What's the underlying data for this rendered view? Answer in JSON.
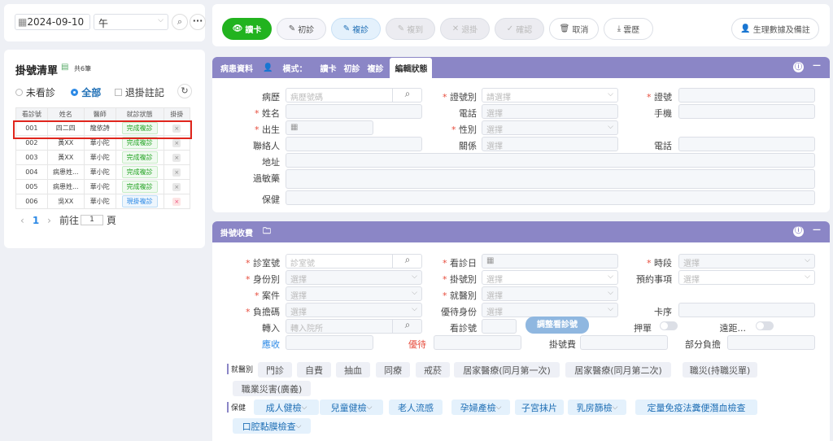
{
  "top": {
    "date": "2024-09-10",
    "session": "午"
  },
  "toolbar": {
    "read_card": "讀卡",
    "first_visit": "初診",
    "revisit": "複診",
    "cut": "複到",
    "clear": "退掛",
    "confirm": "確認",
    "cancel": "取消",
    "cloud": "雲歷",
    "vitals": "生理數據及備註"
  },
  "queue": {
    "title": "掛號清單",
    "total": "共6筆",
    "radio_unseen": "未看診",
    "radio_all": "全部",
    "check_cancelled": "退掛註記",
    "headers": [
      "看診號",
      "姓名",
      "醫師",
      "就診狀態",
      "掛掛"
    ],
    "rows": [
      {
        "no": "001",
        "name": "四二四",
        "doctor": "龍依詩",
        "status": "完成複診",
        "kind": "g",
        "x": "×",
        "xk": ""
      },
      {
        "no": "002",
        "name": "黃XX",
        "doctor": "華小陀",
        "status": "完成複診",
        "kind": "g",
        "x": "×",
        "xk": ""
      },
      {
        "no": "003",
        "name": "黃XX",
        "doctor": "華小陀",
        "status": "完成複診",
        "kind": "g",
        "x": "×",
        "xk": ""
      },
      {
        "no": "004",
        "name": "病患姓...",
        "doctor": "華小陀",
        "status": "完成複診",
        "kind": "g",
        "x": "×",
        "xk": ""
      },
      {
        "no": "005",
        "name": "病患姓...",
        "doctor": "華小陀",
        "status": "完成複診",
        "kind": "g",
        "x": "×",
        "xk": ""
      },
      {
        "no": "006",
        "name": "吳XX",
        "doctor": "華小陀",
        "status": "現掛複診",
        "kind": "b",
        "x": "×",
        "xk": "r"
      }
    ],
    "page": "1",
    "goto": "前往",
    "goto_val": "1",
    "page_unit": "頁"
  },
  "patient": {
    "tabs": [
      "病患資料",
      "模式：",
      "讀卡",
      "初診",
      "複診",
      "編輯狀態"
    ],
    "l_record": "病歷",
    "record_ph": "病歷號碼",
    "l_idtype": "證號別",
    "idtype_ph": "請選擇",
    "l_idno": "證號",
    "l_name": "姓名",
    "l_phone": "電話",
    "phone_ph": "選擇",
    "l_mobile": "手機",
    "l_birth": "出生",
    "l_gender": "性別",
    "gender_ph": "選擇",
    "l_contact": "聯絡人",
    "l_relation": "關係",
    "relation_ph": "選擇",
    "l_phone2": "電話",
    "l_address": "地址",
    "l_allergy": "過敏藥",
    "l_care": "保健"
  },
  "reg": {
    "title": "掛號收費",
    "l_room": "診室號",
    "room_ph": "診室號",
    "l_date": "看診日",
    "l_period": "時段",
    "period_ph": "選擇",
    "l_identity": "身份別",
    "identity_ph": "選擇",
    "l_regtype": "掛號別",
    "regtype_ph": "選擇",
    "l_appoint": "預約事項",
    "appoint_ph": "選擇",
    "l_case": "案件",
    "case_ph": "選擇",
    "l_dept": "就醫別",
    "dept_ph": "選擇",
    "l_copay": "負擔碼",
    "copay_ph": "選擇",
    "l_priority": "優待身份",
    "priority_ph": "選擇",
    "l_card": "卡序",
    "l_transfer": "轉入",
    "transfer_ph": "轉入院所",
    "l_visitno": "看診號",
    "adjust": "調整看診號",
    "l_deposit": "押單",
    "l_remote": "遠距...",
    "l_receivable": "應收",
    "l_discount": "優待",
    "l_fee": "掛號費",
    "l_partial": "部分負擔",
    "dept_label": "就醫別",
    "depts": [
      "門診",
      "自費",
      "抽血",
      "同療",
      "戒菸",
      "居家醫療(同月第一次)",
      "居家醫療(同月第二次)",
      "職災(持職災單)",
      "職業災害(廣義)"
    ],
    "care_label": "保健",
    "cares": [
      "成人健檢",
      "兒童健檢",
      "老人流感",
      "孕婦產檢",
      "子宮抹片",
      "乳房篩檢",
      "定量免疫法糞便潛血檢查",
      "口腔黏膜檢查"
    ]
  }
}
